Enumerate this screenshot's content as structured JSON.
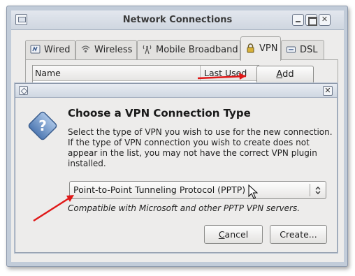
{
  "window": {
    "title": "Network Connections",
    "tabs": [
      {
        "label": "Wired",
        "icon": "wired-network-icon"
      },
      {
        "label": "Wireless",
        "icon": "wireless-icon"
      },
      {
        "label": "Mobile Broadband",
        "icon": "mobile-broadband-icon"
      },
      {
        "label": "VPN",
        "icon": "vpn-lock-icon",
        "active": true
      },
      {
        "label": "DSL",
        "icon": "dsl-icon"
      }
    ],
    "list": {
      "columns": [
        "Name",
        "Last Used"
      ]
    },
    "add_button": {
      "label": "Add",
      "mnemonic": "A"
    }
  },
  "dialog": {
    "heading": "Choose a VPN Connection Type",
    "description": "Select the type of VPN you wish to use for the new connection.  If the type of VPN connection you wish to create does not appear in the list, you may not have the correct VPN plugin installed.",
    "select": {
      "value": "Point-to-Point Tunneling Protocol (PPTP)"
    },
    "compat_text": "Compatible with Microsoft and other PPTP VPN servers.",
    "cancel_button": {
      "mnemonic": "C",
      "rest": "ancel"
    },
    "create_button": {
      "label": "Create..."
    }
  },
  "colors": {
    "annotation_arrow": "#e01818",
    "titlebar": "#cfd6e0",
    "dialog_bg": "#edeceb"
  }
}
